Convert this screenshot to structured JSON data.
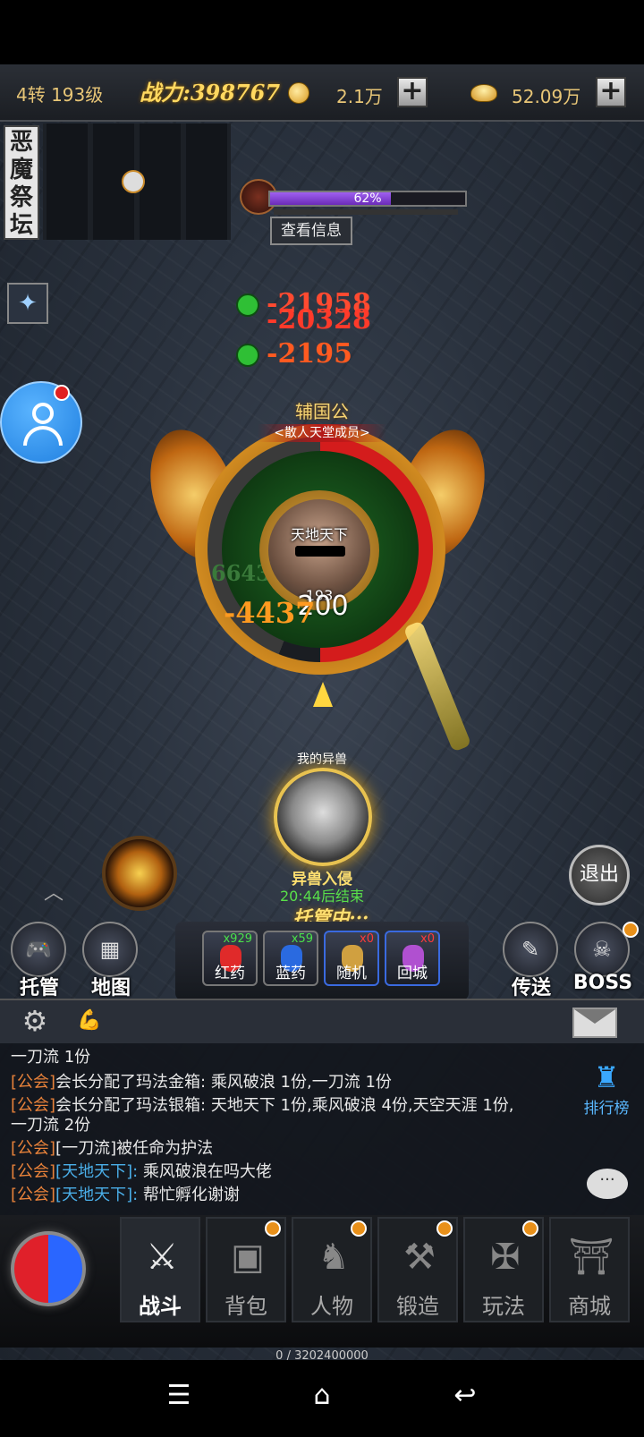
{
  "topbar": {
    "level": "4转 193级",
    "power": "战力:398767",
    "coins": "2.1万",
    "ingots": "52.09万",
    "plus_symbol": "+"
  },
  "map": {
    "name": "恶魔祭坛"
  },
  "target": {
    "hp_percent_text": "62%",
    "hp_fraction": 0.62,
    "info_button": "查看信息"
  },
  "damage": {
    "d1": "-21958",
    "d2": "-20328",
    "d3": "-2195",
    "d4": "-4437",
    "d5": "6643"
  },
  "player": {
    "rank_title": "辅国公",
    "guild": "<散人天堂成员>",
    "name": "天地天下",
    "level": "193",
    "hp_value": "200"
  },
  "pet": {
    "label": "我的异兽",
    "event_title": "异兽入侵",
    "event_time": "20:44后结束",
    "auto_status": "托管中···"
  },
  "buttons": {
    "exit": "退出",
    "auto": "托管",
    "map": "地图",
    "teleport": "传送",
    "boss": "BOSS"
  },
  "potions": [
    {
      "label": "红药",
      "count": "x929",
      "color": "#e02a2a"
    },
    {
      "label": "蓝药",
      "count": "x59",
      "color": "#2a6ae0"
    },
    {
      "label": "随机",
      "count": "x0",
      "color": "#d0a040"
    },
    {
      "label": "回城",
      "count": "x0",
      "color": "#b050d0"
    }
  ],
  "chat": {
    "lines": [
      {
        "tag": "",
        "who": "",
        "text": "一刀流 1份"
      },
      {
        "tag": "[公会]",
        "who": "",
        "text": "会长分配了玛法金箱: 乘风破浪 1份,一刀流 1份"
      },
      {
        "tag": "[公会]",
        "who": "",
        "text": "会长分配了玛法银箱: 天地天下 1份,乘风破浪 4份,天空天涯 1份,"
      },
      {
        "tag": "",
        "who": "",
        "text": "一刀流 2份"
      },
      {
        "tag": "[公会]",
        "who": "",
        "text": "[一刀流]被任命为护法"
      },
      {
        "tag": "[公会]",
        "who": "[天地天下]:",
        "text": " 乘风破浪在吗大佬"
      },
      {
        "tag": "[公会]",
        "who": "[天地天下]:",
        "text": " 帮忙孵化谢谢"
      }
    ],
    "rank_label": "排行榜"
  },
  "nav": {
    "tabs": [
      "战斗",
      "背包",
      "人物",
      "锻造",
      "玩法",
      "商城"
    ],
    "exp": "0 / 3202400000"
  },
  "colors": {
    "gold": "#ffd860",
    "guild_tag": "#e8823a",
    "player_tag": "#4aaee8",
    "hp_red": "#d41c1c"
  }
}
